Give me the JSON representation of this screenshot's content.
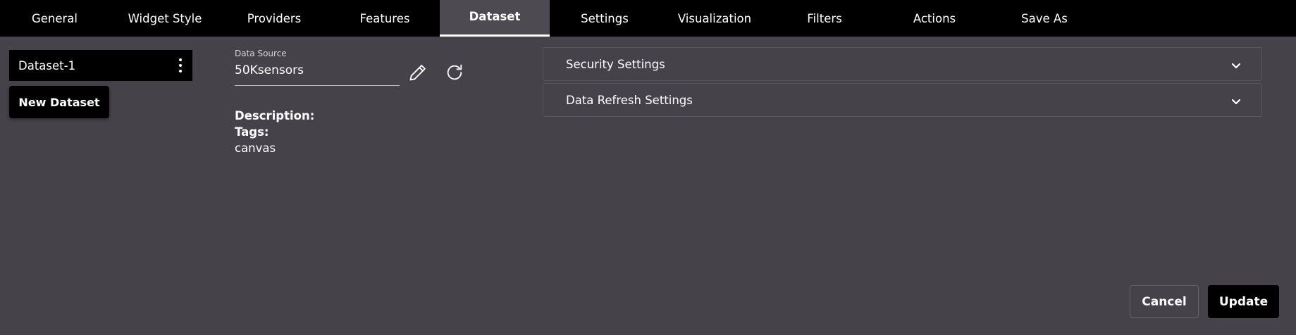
{
  "tabs": [
    {
      "label": "General"
    },
    {
      "label": "Widget Style"
    },
    {
      "label": "Providers"
    },
    {
      "label": "Features"
    },
    {
      "label": "Dataset"
    },
    {
      "label": "Settings"
    },
    {
      "label": "Visualization"
    },
    {
      "label": "Filters"
    },
    {
      "label": "Actions"
    },
    {
      "label": "Save As"
    }
  ],
  "active_tab": "Dataset",
  "sidebar": {
    "datasets": [
      {
        "label": "Dataset-1"
      }
    ],
    "new_dataset_label": "New Dataset"
  },
  "data_source": {
    "label": "Data Source",
    "value": "50Ksensors"
  },
  "meta": {
    "description_label": "Description:",
    "tags_label": "Tags:",
    "tags_value": "canvas"
  },
  "accordions": [
    {
      "label": "Security Settings"
    },
    {
      "label": "Data Refresh Settings"
    }
  ],
  "footer": {
    "cancel_label": "Cancel",
    "update_label": "Update"
  },
  "colors": {
    "background": "#46424a",
    "tabbar": "#000000",
    "active_tab": "#4d4a52"
  },
  "icons": [
    "kebab-menu-icon",
    "pencil-icon",
    "refresh-icon",
    "chevron-down-icon"
  ]
}
